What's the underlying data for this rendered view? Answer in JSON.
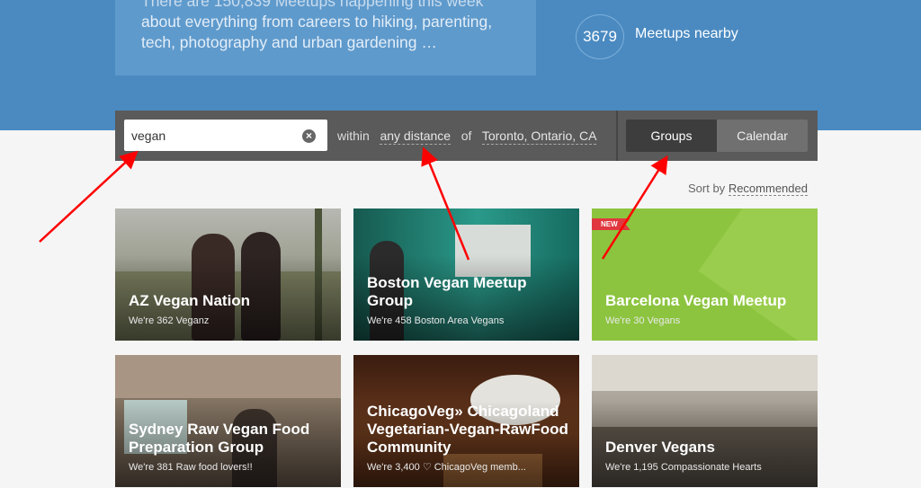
{
  "hero": {
    "line1": "There are 150,839 Meetups happening this week",
    "line2": "about everything from careers to hiking, parenting,",
    "line3": "tech, photography and urban gardening …",
    "count": "3679",
    "count_label": "Meetups nearby"
  },
  "search": {
    "value": "vegan",
    "within": "within",
    "distance": "any distance",
    "of": "of",
    "location": "Toronto, Ontario, CA",
    "tab_groups": "Groups",
    "tab_calendar": "Calendar"
  },
  "sort": {
    "label": "Sort by",
    "value": "Recommended"
  },
  "cards": [
    {
      "title": "AZ Vegan Nation",
      "sub": "We're 362 Veganz"
    },
    {
      "title": "Boston Vegan Meetup Group",
      "sub": "We're 458 Boston Area Vegans"
    },
    {
      "title": "Barcelona Vegan Meetup",
      "sub": "We're 30 Vegans",
      "badge": "NEW"
    },
    {
      "title": "Sydney Raw Vegan Food Preparation Group",
      "sub": "We're 381 Raw food lovers!!"
    },
    {
      "title": "ChicagoVeg» Chicagoland Vegetarian-Vegan-RawFood Community",
      "sub": "We're 3,400 ♡ ChicagoVeg memb..."
    },
    {
      "title": "Denver Vegans",
      "sub": "We're 1,195 Compassionate Hearts"
    }
  ],
  "colors": {
    "hero_bg": "#4a8ac1",
    "search_bar": "#5a5a5a",
    "badge": "#e0383e",
    "annotation_arrow": "#ff0000"
  }
}
